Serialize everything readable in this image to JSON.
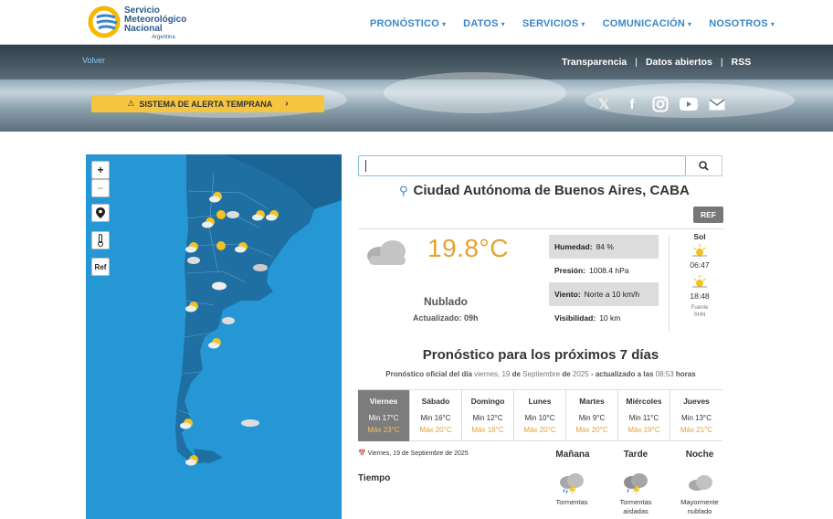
{
  "header": {
    "logo_lines": [
      "Servicio",
      "Meteorológico",
      "Nacional"
    ],
    "logo_sub": "Argentina",
    "nav": [
      {
        "label": "PRONÓSTICO"
      },
      {
        "label": "DATOS"
      },
      {
        "label": "SERVICIOS"
      },
      {
        "label": "COMUNICACIÓN"
      },
      {
        "label": "NOSOTROS"
      }
    ],
    "nav_caret": "▾"
  },
  "hero": {
    "back_label": "Volver",
    "links": [
      "Transparencia",
      "Datos abiertos",
      "RSS"
    ],
    "separator": "|",
    "alert_label": "SISTEMA DE ALERTA TEMPRANA",
    "social_icons": [
      "x-icon",
      "facebook-icon",
      "instagram-icon",
      "youtube-icon",
      "mail-icon"
    ]
  },
  "map": {
    "controls": [
      "+",
      "−",
      "Ref"
    ]
  },
  "search": {
    "placeholder": ""
  },
  "location": {
    "name": "Ciudad Autónoma de Buenos Aires, CABA",
    "ref_label": "REF"
  },
  "current": {
    "temperature": "19.8°C",
    "condition": "Nublado",
    "updated": "Actualizado: 09h",
    "details": [
      {
        "label": "Humedad:",
        "value": "84 %"
      },
      {
        "label": "Presión:",
        "value": "1008.4 hPa"
      },
      {
        "label": "Viento:",
        "value": "Norte a 10 km/h"
      },
      {
        "label": "Visibilidad:",
        "value": "10 km"
      }
    ],
    "sun": {
      "title": "Sol",
      "sunrise": "06:47",
      "sunset": "18:48",
      "source_line1": "Fuente",
      "source_line2": "SHN"
    }
  },
  "forecast": {
    "title": "Pronóstico para los próximos 7 días",
    "subtitle_pre": "Pronóstico oficial del día",
    "subtitle_date_a": "viernes, 19",
    "subtitle_de1": "de",
    "subtitle_month": "Septiembre",
    "subtitle_de2": "de",
    "subtitle_year": "2025",
    "subtitle_post": "- actualizado a las",
    "subtitle_time": "08:53",
    "subtitle_end": "horas",
    "days": [
      {
        "name": "Viernes",
        "min": "Min 17°C",
        "max": "Máx 23°C",
        "selected": true
      },
      {
        "name": "Sábado",
        "min": "Min 16°C",
        "max": "Máx 20°C"
      },
      {
        "name": "Domingo",
        "min": "Min 12°C",
        "max": "Máx 18°C"
      },
      {
        "name": "Lunes",
        "min": "Min 10°C",
        "max": "Máx 20°C"
      },
      {
        "name": "Martes",
        "min": "Min 9°C",
        "max": "Máx 20°C"
      },
      {
        "name": "Miércoles",
        "min": "Min 11°C",
        "max": "Máx 19°C"
      },
      {
        "name": "Jueves",
        "min": "Min 13°C",
        "max": "Máx 21°C"
      }
    ],
    "detail_date": "Viernes, 19 de Septiembre de 2025",
    "periods": [
      "Mañana",
      "Tarde",
      "Noche"
    ],
    "row_label": "Tiempo",
    "conditions": [
      {
        "line1": "Tormentas",
        "line2": ""
      },
      {
        "line1": "Tormentas",
        "line2": "aisladas"
      },
      {
        "line1": "Mayormente",
        "line2": "nublado"
      }
    ]
  },
  "colors": {
    "accent_blue": "#3a87c8",
    "alert_yellow": "#f6c53f",
    "temp_orange": "#e4a233",
    "map_sea": "#2597d4",
    "map_land": "#1f6fa3"
  }
}
